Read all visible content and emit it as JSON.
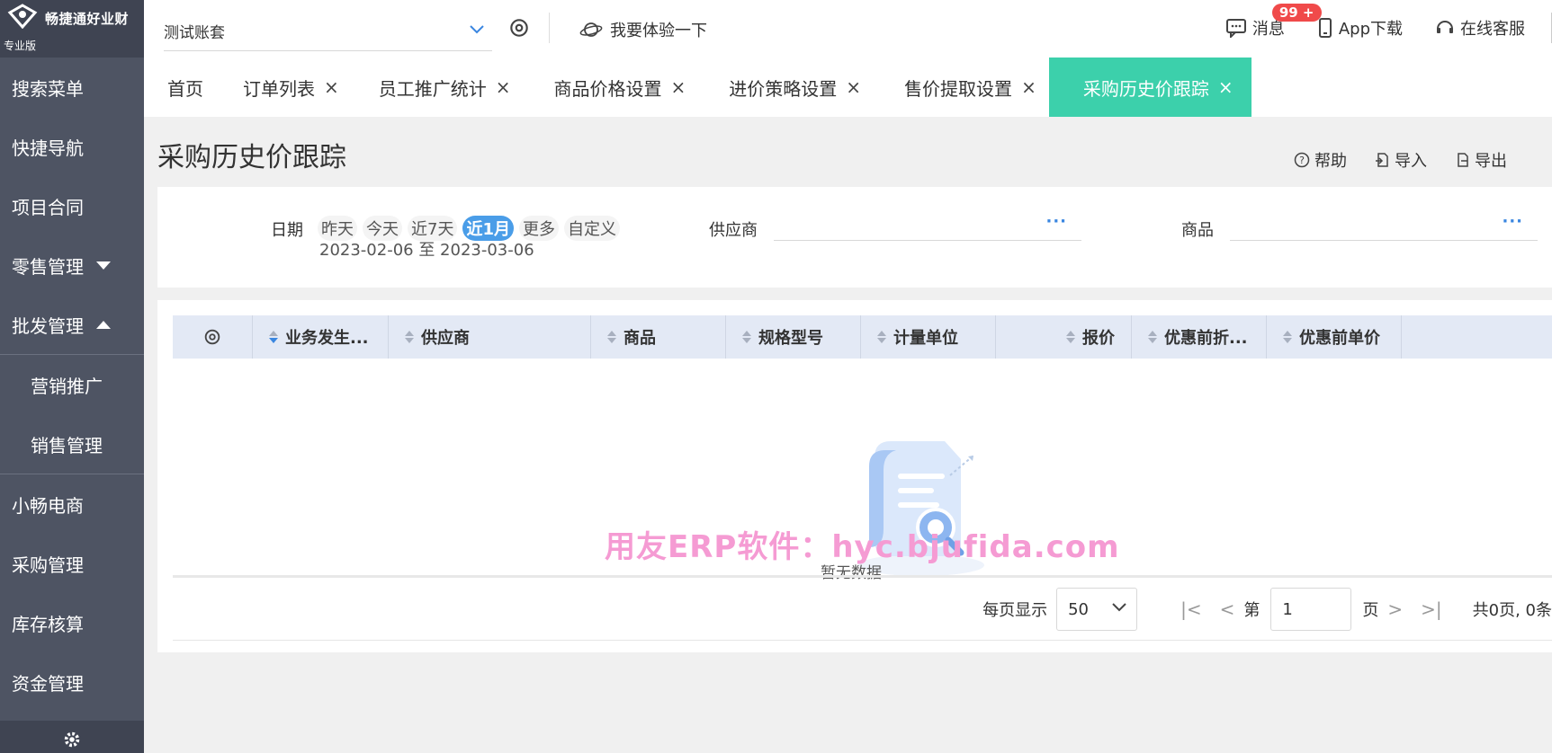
{
  "brand": {
    "name": "畅捷通好业财",
    "edition": "专业版"
  },
  "sidebar": {
    "items": [
      {
        "label": "搜索菜单"
      },
      {
        "label": "快捷导航"
      },
      {
        "label": "项目合同"
      },
      {
        "label": "零售管理"
      },
      {
        "label": "批发管理"
      }
    ],
    "submenu": [
      {
        "label": "营销推广"
      },
      {
        "label": "销售管理"
      }
    ],
    "items_after": [
      {
        "label": "小畅电商"
      },
      {
        "label": "采购管理"
      },
      {
        "label": "库存核算"
      },
      {
        "label": "资金管理"
      }
    ]
  },
  "topbar": {
    "account": "测试账套",
    "try_label": "我要体验一下",
    "messages_label": "消息",
    "messages_badge": "99 +",
    "app_label": "App下载",
    "service_label": "在线客服"
  },
  "tabs": [
    {
      "label": "首页",
      "closable": false
    },
    {
      "label": "订单列表",
      "closable": true
    },
    {
      "label": "员工推广统计",
      "closable": true
    },
    {
      "label": "商品价格设置",
      "closable": true
    },
    {
      "label": "进价策略设置",
      "closable": true
    },
    {
      "label": "售价提取设置",
      "closable": true
    },
    {
      "label": "采购历史价跟踪",
      "closable": true,
      "active": true
    }
  ],
  "page": {
    "title": "采购历史价跟踪",
    "help_label": "帮助",
    "import_label": "导入",
    "export_label": "导出"
  },
  "filters": {
    "date_label": "日期",
    "date_chips": [
      "昨天",
      "今天",
      "近7天",
      "近1月",
      "更多",
      "自定义"
    ],
    "active_chip": "近1月",
    "date_range": "2023-02-06 至 2023-03-06",
    "supplier_label": "供应商",
    "product_label": "商品",
    "dots": "···"
  },
  "grid": {
    "columns": [
      "业务发生...",
      "供应商",
      "商品",
      "规格型号",
      "计量单位",
      "报价",
      "优惠前折...",
      "优惠前单价"
    ],
    "empty_text": "暂无数据",
    "watermark": "用友ERP软件：hyc.bjufida.com"
  },
  "pager": {
    "per_page_label": "每页显示",
    "per_page_value": "50",
    "page_prefix": "第",
    "page_value": "1",
    "page_suffix": "页",
    "total": "共0页, 0条"
  },
  "colors": {
    "sidebar": "#4e5463",
    "active_tab": "#3cd0ab",
    "accent": "#4a9de8",
    "badge": "#f04a4a"
  }
}
